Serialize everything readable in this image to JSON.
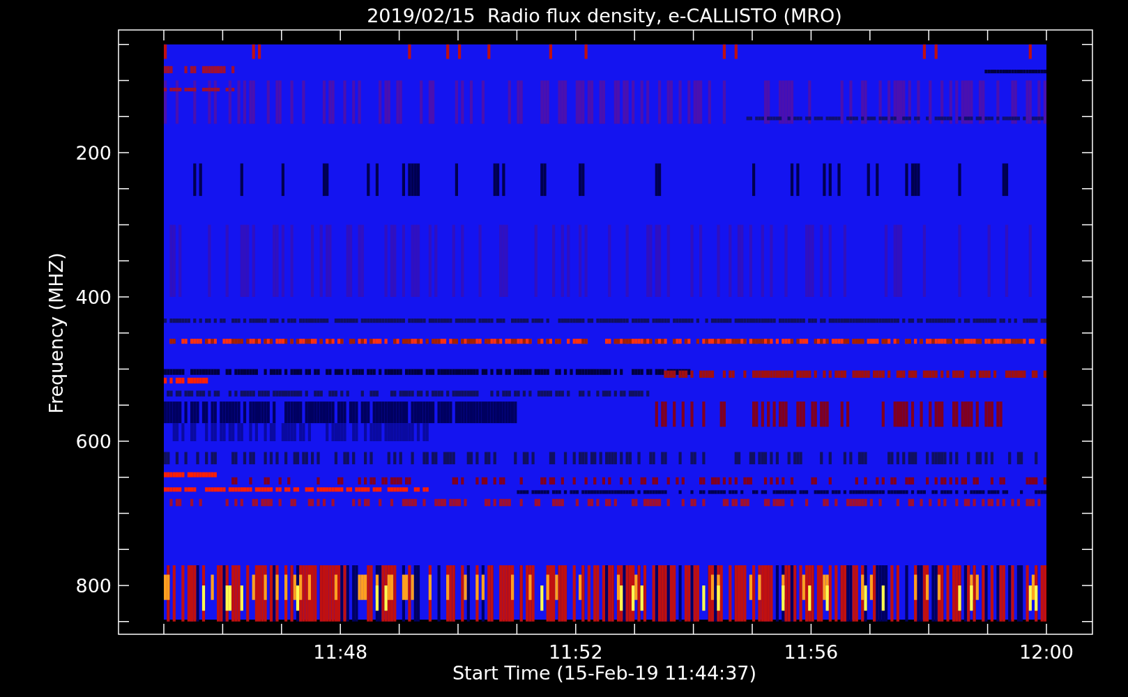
{
  "title": "2019/02/15  Radio flux density, e-CALLISTO (MRO)",
  "y_axis": {
    "label": "Frequency (MHZ)",
    "tick_labels": [
      "200",
      "400",
      "600",
      "800"
    ]
  },
  "x_axis": {
    "label": "Start Time (15-Feb-19 11:44:37)",
    "tick_labels": [
      "11:48",
      "11:52",
      "11:56",
      "12:00"
    ]
  }
}
